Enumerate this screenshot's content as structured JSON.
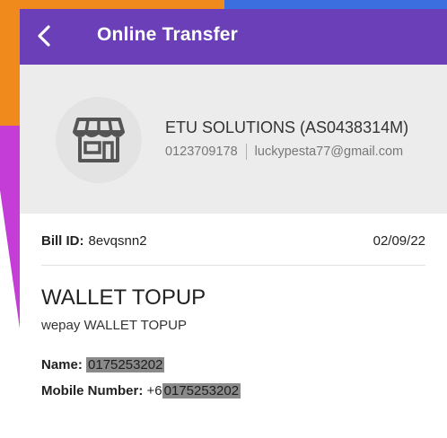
{
  "header": {
    "title": "Online Transfer"
  },
  "merchant": {
    "name": "ETU SOLUTIONS (AS0438314M)",
    "phone": "0123709178",
    "email": "luckypesta77@gmail.com",
    "icon": "store-icon"
  },
  "bill": {
    "id_label": "Bill ID:",
    "id_value": "8evqsnn2",
    "date": "02/09/22"
  },
  "product": {
    "title": "WALLET TOPUP",
    "subtitle": "wepay WALLET TOPUP"
  },
  "fields": {
    "name_label": "Name:",
    "name_value": "0175253202",
    "mobile_label": "Mobile Number:",
    "mobile_prefix": "+6",
    "mobile_value": "0175253202"
  },
  "colors": {
    "topbar": "#6a3fb8",
    "merchant_bg": "#ececec",
    "redaction": "#8a8a8a"
  }
}
